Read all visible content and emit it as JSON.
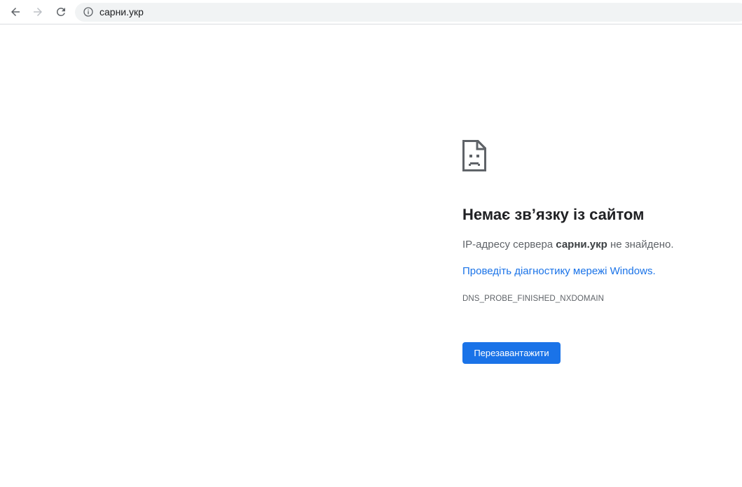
{
  "toolbar": {
    "back_icon": "arrow-back-icon",
    "forward_icon": "arrow-forward-icon",
    "reload_icon": "reload-icon",
    "info_icon": "info-icon",
    "url": "сарни.укр"
  },
  "error": {
    "icon": "sad-page-icon",
    "title": "Немає зв’язку із сайтом",
    "message_prefix": "IP-адресу сервера ",
    "host": "сарни.укр",
    "message_suffix": " не знайдено.",
    "diagnostics_link": "Проведіть діагностику мережі Windows.",
    "error_code": "DNS_PROBE_FINISHED_NXDOMAIN",
    "reload_label": "Перезавантажити"
  },
  "colors": {
    "accent": "#1a73e8",
    "omnibox_bg": "#f1f3f4",
    "text_primary": "#202124",
    "text_secondary": "#5f6368"
  }
}
